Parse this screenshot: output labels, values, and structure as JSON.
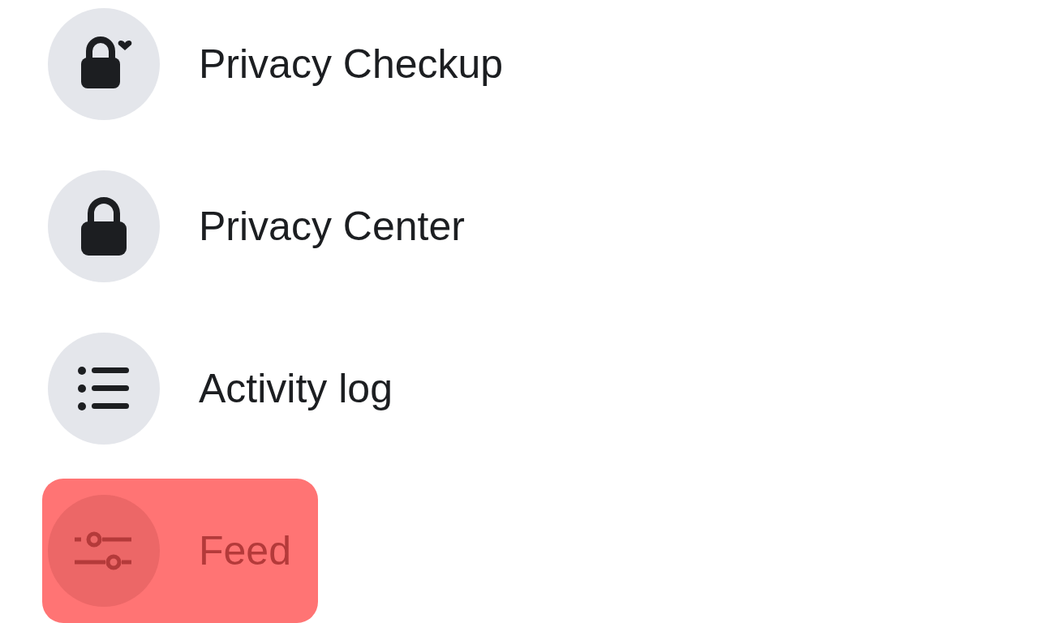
{
  "menu": {
    "items": [
      {
        "kind": "privacy-checkup",
        "label": "Privacy Checkup",
        "highlighted": false
      },
      {
        "kind": "lock",
        "label": "Privacy Center",
        "highlighted": false
      },
      {
        "kind": "list",
        "label": "Activity log",
        "highlighted": false
      },
      {
        "kind": "sliders",
        "label": "Feed",
        "highlighted": true
      }
    ]
  }
}
